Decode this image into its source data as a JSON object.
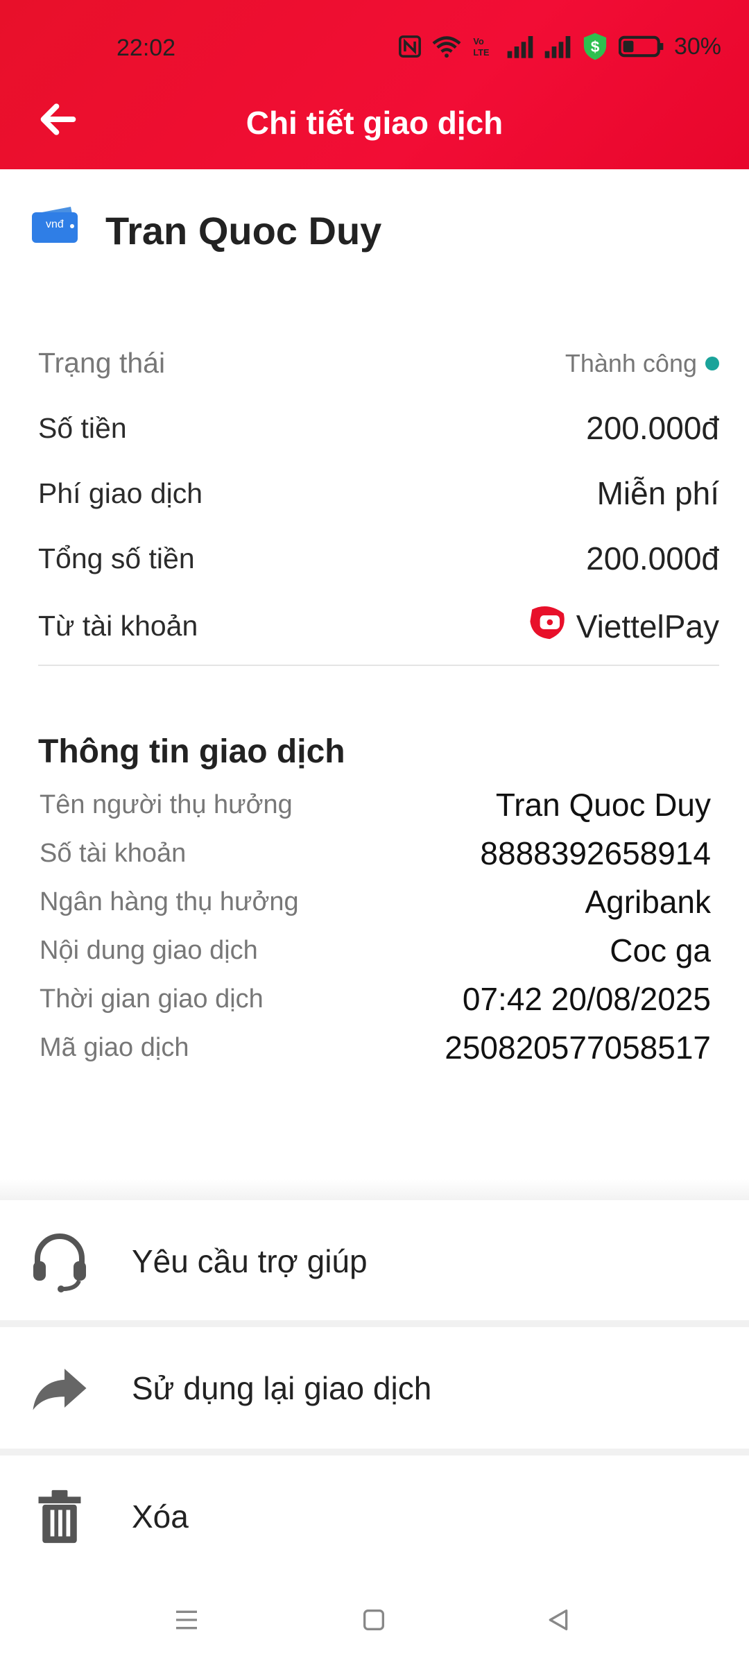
{
  "status_bar": {
    "time": "22:02",
    "battery": "30%"
  },
  "header": {
    "title": "Chi tiết giao dịch"
  },
  "recipient": {
    "name": "Tran Quoc Duy",
    "wallet_icon_label": "vnđ"
  },
  "summary": {
    "status_label": "Trạng thái",
    "status_value": "Thành công",
    "amount_label": "Số tiền",
    "amount_value": "200.000đ",
    "fee_label": "Phí giao dịch",
    "fee_value": "Miễn phí",
    "total_label": "Tổng số tiền",
    "total_value": "200.000đ",
    "from_label": "Từ tài khoản",
    "from_value": "ViettelPay"
  },
  "details": {
    "title": "Thông tin giao dịch",
    "rows": [
      {
        "label": "Tên người thụ hưởng",
        "value": "Tran Quoc Duy"
      },
      {
        "label": "Số tài khoản",
        "value": "8888392658914"
      },
      {
        "label": "Ngân hàng thụ hưởng",
        "value": "Agribank"
      },
      {
        "label": "Nội dung giao dịch",
        "value": "Coc ga"
      },
      {
        "label": "Thời gian giao dịch",
        "value": "07:42 20/08/2025"
      },
      {
        "label": "Mã giao dịch",
        "value": "250820577058517"
      }
    ]
  },
  "actions": [
    {
      "label": "Yêu cầu trợ giúp",
      "icon": "headset-icon"
    },
    {
      "label": "Sử dụng lại giao dịch",
      "icon": "share-arrow-icon"
    },
    {
      "label": "Xóa",
      "icon": "trash-icon"
    }
  ],
  "colors": {
    "brand_red": "#ee0033",
    "status_green": "#1aa39a"
  }
}
